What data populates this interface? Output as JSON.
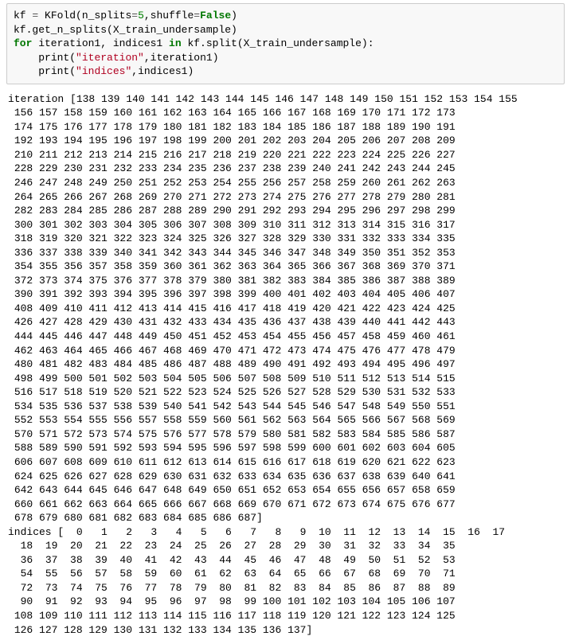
{
  "code": {
    "l1": {
      "a": "kf ",
      "eq": "= ",
      "b": "KFold",
      "p1": "(n_splits",
      "eq2": "=",
      "num": "5",
      "p2": ",shuffle",
      "eq3": "=",
      "kwFalse": "False",
      "p3": ")"
    },
    "l2": "kf.get_n_splits(X_train_undersample)",
    "l3": {
      "kwFor": "for",
      "mid": " iteration1, indices1 ",
      "kwIn": "in",
      "tail": " kf.split(X_train_undersample):"
    },
    "l4": {
      "pad": "    ",
      "fn": "print",
      "p1": "(",
      "s": "\"iteration\"",
      "p2": ",iteration1)"
    },
    "l5": {
      "pad": "    ",
      "fn": "print",
      "p1": "(",
      "s": "\"indices\"",
      "p2": ",indices1)"
    }
  },
  "out": {
    "iterationBlock": "iteration [138 139 140 141 142 143 144 145 146 147 148 149 150 151 152 153 154 155\n 156 157 158 159 160 161 162 163 164 165 166 167 168 169 170 171 172 173\n 174 175 176 177 178 179 180 181 182 183 184 185 186 187 188 189 190 191\n 192 193 194 195 196 197 198 199 200 201 202 203 204 205 206 207 208 209\n 210 211 212 213 214 215 216 217 218 219 220 221 222 223 224 225 226 227\n 228 229 230 231 232 233 234 235 236 237 238 239 240 241 242 243 244 245\n 246 247 248 249 250 251 252 253 254 255 256 257 258 259 260 261 262 263\n 264 265 266 267 268 269 270 271 272 273 274 275 276 277 278 279 280 281\n 282 283 284 285 286 287 288 289 290 291 292 293 294 295 296 297 298 299\n 300 301 302 303 304 305 306 307 308 309 310 311 312 313 314 315 316 317\n 318 319 320 321 322 323 324 325 326 327 328 329 330 331 332 333 334 335\n 336 337 338 339 340 341 342 343 344 345 346 347 348 349 350 351 352 353\n 354 355 356 357 358 359 360 361 362 363 364 365 366 367 368 369 370 371\n 372 373 374 375 376 377 378 379 380 381 382 383 384 385 386 387 388 389\n 390 391 392 393 394 395 396 397 398 399 400 401 402 403 404 405 406 407\n 408 409 410 411 412 413 414 415 416 417 418 419 420 421 422 423 424 425\n 426 427 428 429 430 431 432 433 434 435 436 437 438 439 440 441 442 443\n 444 445 446 447 448 449 450 451 452 453 454 455 456 457 458 459 460 461\n 462 463 464 465 466 467 468 469 470 471 472 473 474 475 476 477 478 479\n 480 481 482 483 484 485 486 487 488 489 490 491 492 493 494 495 496 497\n 498 499 500 501 502 503 504 505 506 507 508 509 510 511 512 513 514 515\n 516 517 518 519 520 521 522 523 524 525 526 527 528 529 530 531 532 533\n 534 535 536 537 538 539 540 541 542 543 544 545 546 547 548 549 550 551\n 552 553 554 555 556 557 558 559 560 561 562 563 564 565 566 567 568 569\n 570 571 572 573 574 575 576 577 578 579 580 581 582 583 584 585 586 587\n 588 589 590 591 592 593 594 595 596 597 598 599 600 601 602 603 604 605\n 606 607 608 609 610 611 612 613 614 615 616 617 618 619 620 621 622 623\n 624 625 626 627 628 629 630 631 632 633 634 635 636 637 638 639 640 641\n 642 643 644 645 646 647 648 649 650 651 652 653 654 655 656 657 658 659\n 660 661 662 663 664 665 666 667 668 669 670 671 672 673 674 675 676 677\n 678 679 680 681 682 683 684 685 686 687]",
    "indicesBlock": "indices [  0   1   2   3   4   5   6   7   8   9  10  11  12  13  14  15  16  17\n  18  19  20  21  22  23  24  25  26  27  28  29  30  31  32  33  34  35\n  36  37  38  39  40  41  42  43  44  45  46  47  48  49  50  51  52  53\n  54  55  56  57  58  59  60  61  62  63  64  65  66  67  68  69  70  71\n  72  73  74  75  76  77  78  79  80  81  82  83  84  85  86  87  88  89\n  90  91  92  93  94  95  96  97  98  99 100 101 102 103 104 105 106 107\n 108 109 110 111 112 113 114 115 116 117 118 119 120 121 122 123 124 125\n 126 127 128 129 130 131 132 133 134 135 136 137]"
  }
}
